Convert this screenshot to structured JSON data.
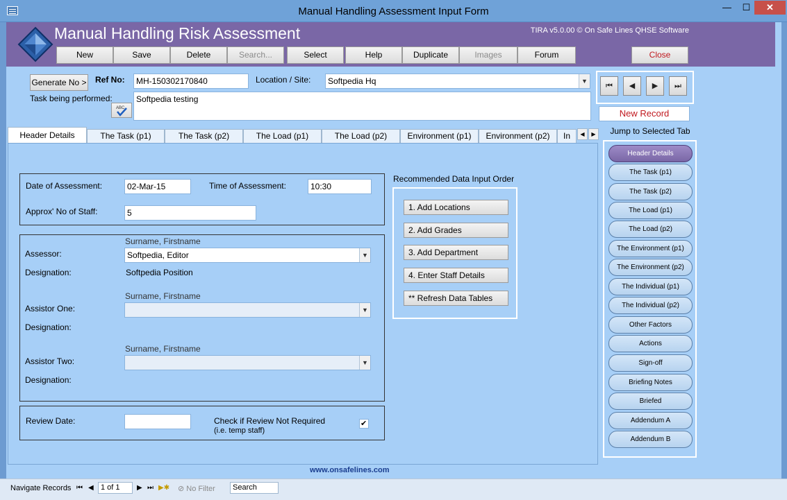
{
  "window": {
    "title": "Manual Handling Assessment Input Form",
    "minimize": "—",
    "maximize": "☐",
    "close": "✕"
  },
  "header": {
    "app_title": "Manual Handling Risk Assessment",
    "version": "TIRA v5.0.00 © On Safe Lines QHSE Software",
    "toolbar": {
      "new": "New",
      "save": "Save",
      "delete": "Delete",
      "search": "Search...",
      "select": "Select",
      "help": "Help",
      "duplicate": "Duplicate",
      "images": "Images",
      "forum": "Forum",
      "close": "Close"
    }
  },
  "record": {
    "generate_label": "Generate No >",
    "ref_label": "Ref No:",
    "ref_value": "MH-150302170840",
    "location_label": "Location / Site:",
    "location_value": "Softpedia Hq",
    "task_label": "Task being performed:",
    "task_value": "Softpedia testing",
    "new_record": "New Record"
  },
  "navigation": {
    "first": "⏮",
    "prev": "◀",
    "next": "▶",
    "last": "⏭"
  },
  "tabs": [
    {
      "label": "Header Details"
    },
    {
      "label": "The Task (p1)"
    },
    {
      "label": "The Task (p2)"
    },
    {
      "label": "The Load (p1)"
    },
    {
      "label": "The Load (p2)"
    },
    {
      "label": "Environment (p1)"
    },
    {
      "label": "Environment (p2)"
    },
    {
      "label": "In"
    }
  ],
  "tab_scroll": {
    "left": "◀",
    "right": "▶"
  },
  "header_details": {
    "date_label": "Date of Assessment:",
    "date_value": "02-Mar-15",
    "time_label": "Time of Assessment:",
    "time_value": "10:30",
    "staff_label": "Approx' No of Staff:",
    "staff_value": "5",
    "surname_hint": "Surname, Firstname",
    "assessor_label": "Assessor:",
    "assessor_value": "Softpedia, Editor",
    "designation_label": "Designation:",
    "assessor_designation": "Softpedia Position",
    "assistor_one_label": "Assistor One:",
    "assistor_two_label": "Assistor Two:",
    "review_label": "Review Date:",
    "review_check_label": "Check if Review Not Required",
    "review_check_sub": "(i.e. temp staff)",
    "review_checked": "✔"
  },
  "recommended": {
    "title": "Recommended Data Input Order",
    "items": [
      "1. Add Locations",
      "2. Add Grades",
      "3. Add Department",
      "4. Enter Staff Details",
      "** Refresh Data Tables"
    ]
  },
  "jump": {
    "title": "Jump to Selected Tab",
    "items": [
      "Header Details",
      "The Task (p1)",
      "The Task (p2)",
      "The Load (p1)",
      "The Load (p2)",
      "The Environment (p1)",
      "The Environment (p2)",
      "The Individual (p1)",
      "The Individual (p2)",
      "Other Factors",
      "Actions",
      "Sign-off",
      "Briefing Notes",
      "Briefed",
      "Addendum A",
      "Addendum B"
    ]
  },
  "footer": {
    "link": "www.onsafelines.com"
  },
  "statusbar": {
    "navigate_label": "Navigate Records",
    "record_pos": "1 of 1",
    "no_filter": "No Filter",
    "search": "Search"
  },
  "colors": {
    "header_band": "#7a67a6",
    "form_background": "#a7cff7",
    "new_record_text": "#c0181e"
  }
}
